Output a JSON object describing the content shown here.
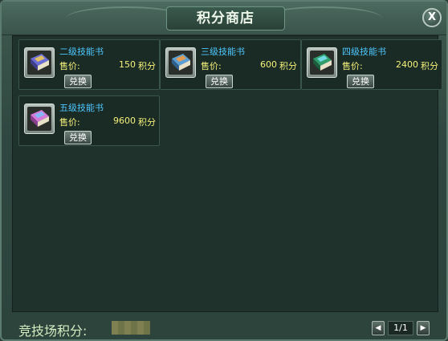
{
  "window": {
    "title": "积分商店",
    "close_label": "X"
  },
  "shop": {
    "price_label": "售价:",
    "price_unit": "积分",
    "exchange_label": "兑换",
    "items": [
      {
        "name": "二级技能书",
        "price": "150",
        "book_color": "#6b6ed8",
        "book_accent": "#ffd34a"
      },
      {
        "name": "三级技能书",
        "price": "600",
        "book_color": "#5aa0d6",
        "book_accent": "#ff9a3a"
      },
      {
        "name": "四级技能书",
        "price": "2400",
        "book_color": "#2f9e6a",
        "book_accent": "#7fe6ff"
      },
      {
        "name": "五级技能书",
        "price": "9600",
        "book_color": "#d67ad8",
        "book_accent": "#6fc8ff"
      }
    ]
  },
  "footer": {
    "points_label": "竞技场积分:",
    "pager": {
      "prev_icon": "◀",
      "text": "1/1",
      "next_icon": "▶"
    }
  },
  "colors": {
    "item_name": "#4fc8ff",
    "price_text": "#f5f27a",
    "footer_label": "#d4ecc0"
  }
}
